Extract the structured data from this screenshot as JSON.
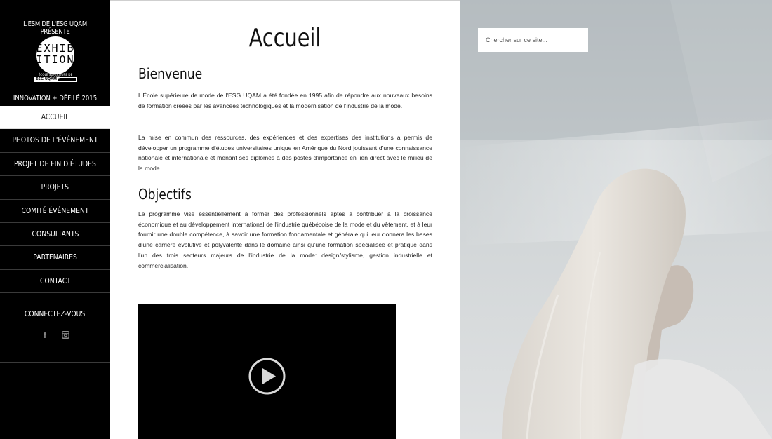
{
  "sidebar": {
    "presents": "L'ESM DE L'ESG UQAM PRÉSENTE",
    "logo": {
      "word_top": "EXHIB",
      "word_bottom": "ITION",
      "school": "ÉCOLE SUPÉRIEURE DE MODE",
      "esg": "ESG UQAM"
    },
    "tagline": "INNOVATION + DÉFILÉ 2015",
    "nav": [
      {
        "label": "ACCUEIL",
        "active": true
      },
      {
        "label": "PHOTOS DE L'ÉVÉNEMENT"
      },
      {
        "label": "PROJET DE FIN D'ÉTUDES"
      },
      {
        "label": "PROJETS"
      },
      {
        "label": "COMITÉ ÉVÉNEMENT"
      },
      {
        "label": "CONSULTANTS"
      },
      {
        "label": "PARTENAIRES"
      },
      {
        "label": "CONTACT"
      }
    ],
    "connect": "CONNECTEZ-VOUS",
    "socials": {
      "facebook": "f",
      "instagram": "instagram-icon"
    }
  },
  "main": {
    "title": "Accueil",
    "welcome_heading": "Bienvenue",
    "p1": "L'École supérieure de mode de l'ESG UQAM a été fondée en 1995 afin de répondre aux nouveaux besoins de formation créées par les avancées technologiques et la modernisation de l'industrie de la mode.",
    "p2": "La mise en commun des ressources, des expériences et des expertises des institutions a permis de développer un programme d'études universitaires unique en Amérique du Nord jouissant d'une connaissance nationale et internationale et menant ses diplômés à des postes d'importance en lien direct avec le milieu de la mode.",
    "objectives_heading": "Objectifs",
    "p3": "Le programme vise essentiellement à former des professionnels aptes à contribuer à la croissance économique et au développement international de l'industrie québécoise de la mode et du vêtement, et à leur fournir une double compétence, à savoir une formation fondamentale et générale qui leur donnera les bases d'une carrière évolutive et polyvalente dans le domaine ainsi qu'une formation spécialisée et pratique dans l'un des trois secteurs majeurs de l'industrie de la mode: design/stylisme, gestion industrielle et commercialisation.",
    "video": {
      "play_icon": "play-icon"
    }
  },
  "search": {
    "placeholder": "Chercher sur ce site..."
  },
  "colors": {
    "sidebar_bg": "#000000",
    "video_bg": "#000000",
    "active_nav_bg": "#ffffff"
  }
}
